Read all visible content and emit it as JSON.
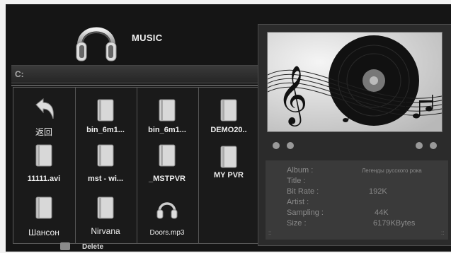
{
  "header": {
    "title": "MUSIC",
    "icon": "headphones-icon"
  },
  "path": {
    "label": "C:"
  },
  "files": [
    {
      "name": "返回",
      "icon": "back-arrow-icon"
    },
    {
      "name": "bin_6m1...",
      "icon": "file-icon"
    },
    {
      "name": "bin_6m1...",
      "icon": "file-icon"
    },
    {
      "name": "DEMO20..",
      "icon": "file-icon"
    },
    {
      "name": "11111.avi",
      "icon": "file-icon"
    },
    {
      "name": "mst - wi...",
      "icon": "file-icon"
    },
    {
      "name": "_MSTPVR",
      "icon": "file-icon"
    },
    {
      "name": "MY PVR",
      "icon": "file-icon"
    },
    {
      "name": "Шансон",
      "icon": "file-icon"
    },
    {
      "name": "Nirvana",
      "icon": "file-icon"
    },
    {
      "name": "Doors.mp3",
      "icon": "headphones-icon"
    }
  ],
  "info": {
    "album_label": "Album :",
    "album_value": "Легенды русского рока",
    "title_label": "Title :",
    "title_value": "",
    "bitrate_label": "Bit Rate :",
    "bitrate_value": "192K",
    "artist_label": "Artist :",
    "artist_value": "",
    "sampling_label": "Sampling :",
    "sampling_value": "44K",
    "size_label": "Size :",
    "size_value": "6179KBytes"
  },
  "footer": {
    "delete_label": "Delete"
  },
  "colors": {
    "background": "#151515",
    "panel": "#2b2b2b",
    "text": "#eeeeee"
  }
}
